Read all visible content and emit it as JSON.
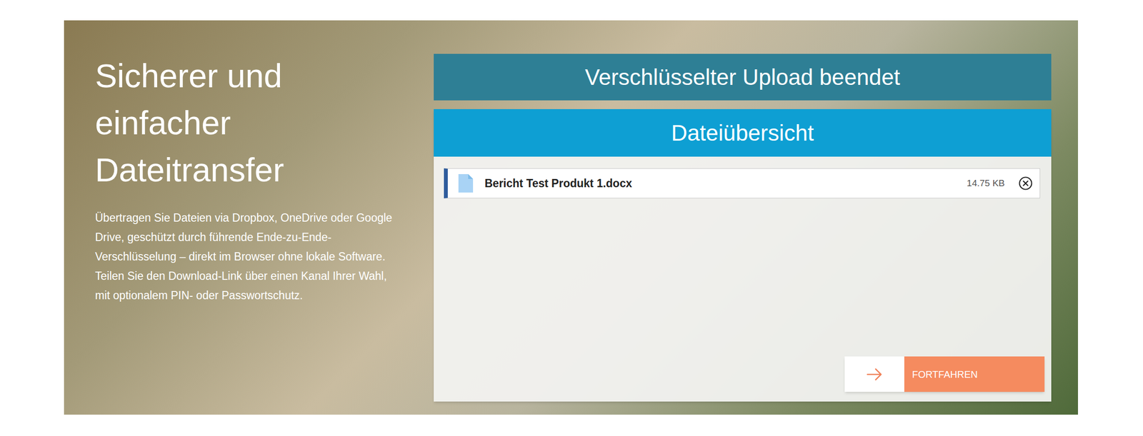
{
  "hero": {
    "title": "Sicherer und einfacher Dateitransfer",
    "description": "Übertragen Sie Dateien via Dropbox, OneDrive oder Google Drive, geschützt durch führende Ende-zu-Ende-Verschlüsselung – direkt im Browser ohne lokale Software. Teilen Sie den Download-Link über einen Kanal Ihrer Wahl, mit optionalem PIN- oder Passwortschutz."
  },
  "status": {
    "title": "Verschlüsselter Upload beendet"
  },
  "file_overview": {
    "title": "Dateiübersicht",
    "files": [
      {
        "name": "Bericht Test Produkt 1.docx",
        "size": "14.75 KB"
      }
    ]
  },
  "buttons": [
    {
      "label": "FORTFAHREN"
    }
  ]
}
